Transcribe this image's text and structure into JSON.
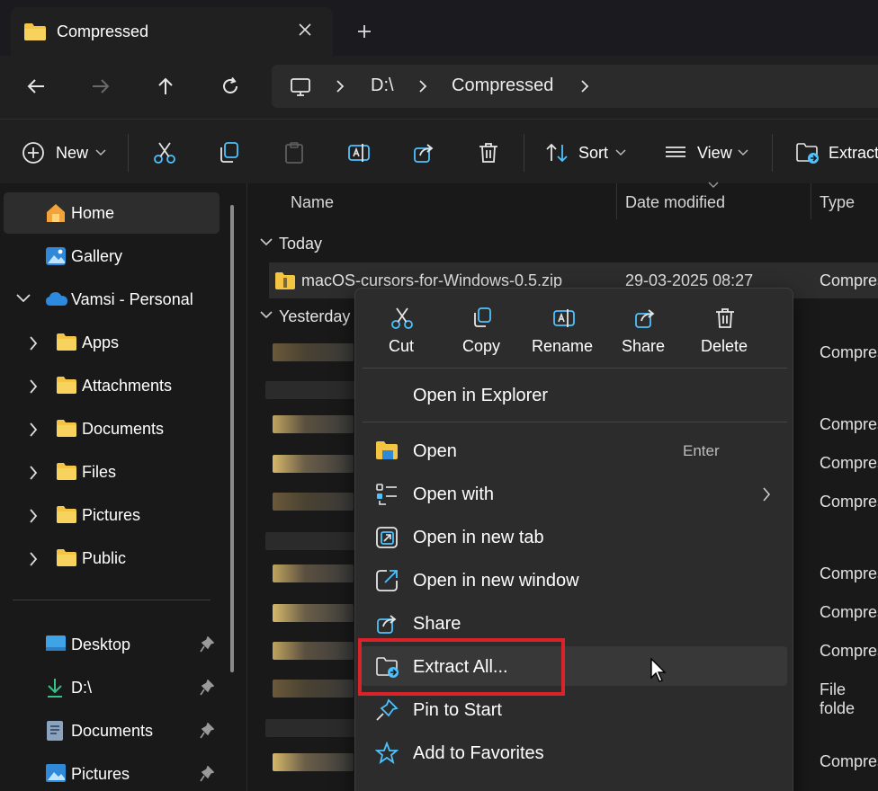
{
  "tab": {
    "title": "Compressed"
  },
  "address": {
    "segments": [
      "D:\\",
      "Compressed"
    ]
  },
  "toolbar": {
    "new_label": "New",
    "sort_label": "Sort",
    "view_label": "View",
    "extract_label": "Extract"
  },
  "sidebar": {
    "home": "Home",
    "gallery": "Gallery",
    "onedrive": "Vamsi - Personal",
    "folders": [
      "Apps",
      "Attachments",
      "Documents",
      "Files",
      "Pictures",
      "Public"
    ],
    "pinned": [
      "Desktop",
      "D:\\",
      "Documents",
      "Pictures"
    ]
  },
  "list": {
    "columns": [
      "Name",
      "Date modified",
      "Type"
    ],
    "groups": [
      "Today",
      "Yesterday"
    ],
    "selected": {
      "name": "macOS-cursors-for-Windows-0.5.zip",
      "date": "29-03-2025 08:27",
      "type": "Compres"
    },
    "types": [
      "Compres",
      "Compres",
      "Compres",
      "Compres",
      "Compres",
      "Compres",
      "Compres",
      "File folde",
      "Compres"
    ]
  },
  "context_menu": {
    "quick_actions": [
      "Cut",
      "Copy",
      "Rename",
      "Share",
      "Delete"
    ],
    "open_in_explorer": "Open in Explorer",
    "items": [
      {
        "label": "Open",
        "shortcut": "Enter",
        "icon": "folder-icon"
      },
      {
        "label": "Open with",
        "icon": "open-with-icon"
      },
      {
        "label": "Open in new tab",
        "icon": "new-tab-icon"
      },
      {
        "label": "Open in new window",
        "icon": "new-window-icon"
      },
      {
        "label": "Share",
        "icon": "share-icon"
      },
      {
        "label": "Extract All...",
        "icon": "extract-icon"
      },
      {
        "label": "Pin to Start",
        "icon": "pin-icon"
      },
      {
        "label": "Add to Favorites",
        "icon": "star-icon"
      }
    ]
  },
  "colors": {
    "accent": "#4cc2ff",
    "highlight_box": "#d9232b",
    "folder": "#f4c542"
  }
}
